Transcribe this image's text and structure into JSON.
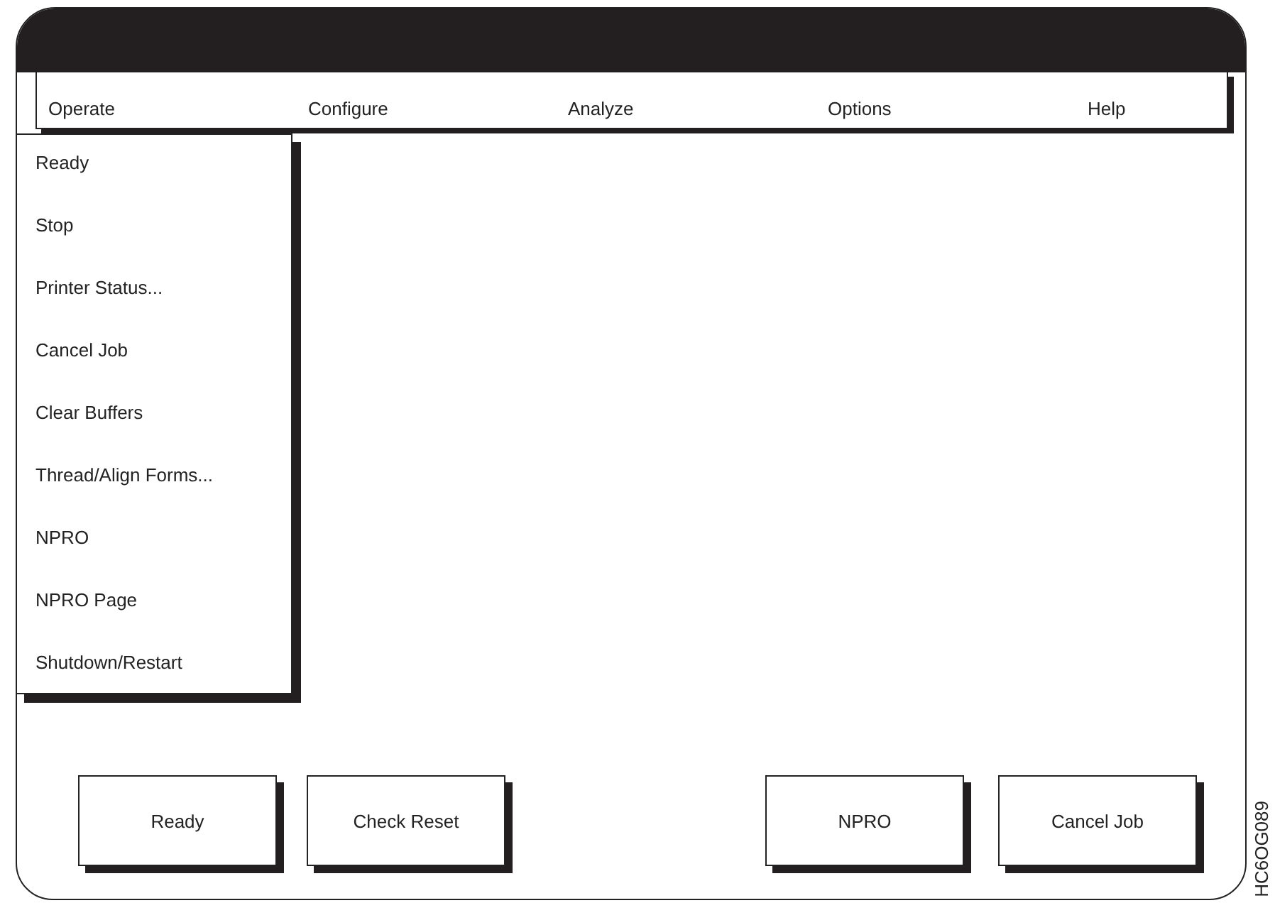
{
  "menu_bar": [
    {
      "label": "Operate",
      "items": [
        "Ready",
        "Stop",
        "Printer Status...",
        "Cancel Job",
        "Clear Buffers",
        "Thread/Align Forms...",
        "NPRO",
        "NPRO Page",
        "Shutdown/Restart"
      ]
    },
    {
      "label": "Configure"
    },
    {
      "label": "Analyze"
    },
    {
      "label": "Options"
    },
    {
      "label": "Help"
    }
  ],
  "buttons": [
    "Ready",
    "Check Reset",
    "NPRO",
    "Cancel Job"
  ],
  "figure_id": "HC6OG089"
}
